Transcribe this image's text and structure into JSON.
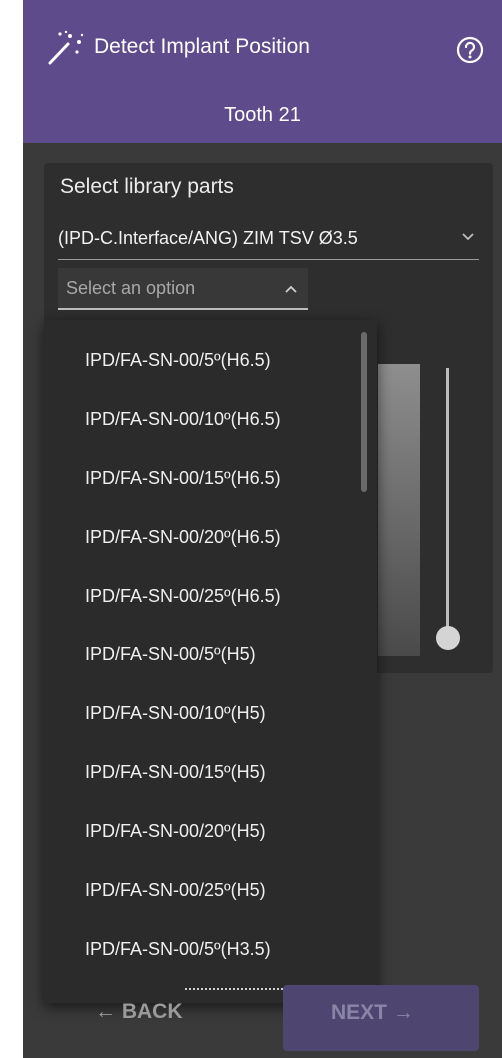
{
  "header": {
    "title": "Detect Implant Position",
    "subtitle": "Tooth 21",
    "icon": "magic-wand-icon",
    "help_icon": "help-circle-icon"
  },
  "card": {
    "title": "Select library parts",
    "library_select": {
      "value": "(IPD-C.Interface/ANG) ZIM TSV Ø3.5",
      "icon": "chevron-down-icon"
    },
    "part_select": {
      "placeholder": "Select an option",
      "icon": "chevron-up-icon"
    }
  },
  "dropdown": {
    "options": [
      "IPD/FA-SN-00/5º(H6.5)",
      "IPD/FA-SN-00/10º(H6.5)",
      "IPD/FA-SN-00/15º(H6.5)",
      "IPD/FA-SN-00/20º(H6.5)",
      "IPD/FA-SN-00/25º(H6.5)",
      "IPD/FA-SN-00/5º(H5)",
      "IPD/FA-SN-00/10º(H5)",
      "IPD/FA-SN-00/15º(H5)",
      "IPD/FA-SN-00/20º(H5)",
      "IPD/FA-SN-00/25º(H5)",
      "IPD/FA-SN-00/5º(H3.5)"
    ]
  },
  "footer": {
    "back_label": "← BACK",
    "next_label": "NEXT →"
  },
  "colors": {
    "header_bg": "#5e4b8b",
    "panel_bg": "#3a3a3a",
    "card_bg": "#2e2e2e",
    "dropdown_bg": "#2b2b2b",
    "next_button_bg": "#4e4670"
  }
}
